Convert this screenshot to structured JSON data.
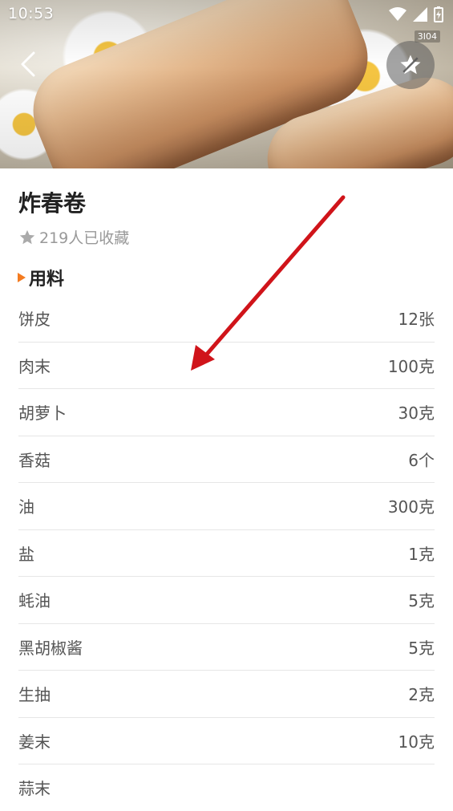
{
  "status_bar": {
    "time": "10:53",
    "speed_badge": "3I04"
  },
  "recipe": {
    "title": "炸春卷",
    "favorites_text": "219人已收藏"
  },
  "ingredients_section": {
    "title": "用料",
    "items": [
      {
        "name": "饼皮",
        "amount": "12张"
      },
      {
        "name": "肉末",
        "amount": "100克"
      },
      {
        "name": "胡萝卜",
        "amount": "30克"
      },
      {
        "name": "香菇",
        "amount": "6个"
      },
      {
        "name": "油",
        "amount": "300克"
      },
      {
        "name": "盐",
        "amount": "1克"
      },
      {
        "name": "蚝油",
        "amount": "5克"
      },
      {
        "name": "黑胡椒酱",
        "amount": "5克"
      },
      {
        "name": "生抽",
        "amount": "2克"
      },
      {
        "name": "姜末",
        "amount": "10克"
      },
      {
        "name": "蒜末",
        "amount": ""
      }
    ]
  },
  "icons": {
    "back": "chevron-left-icon",
    "favorite": "star-icon",
    "favorites_count": "star-icon"
  },
  "colors": {
    "accent": "#f47b20",
    "annotation_arrow": "#d0141a"
  }
}
